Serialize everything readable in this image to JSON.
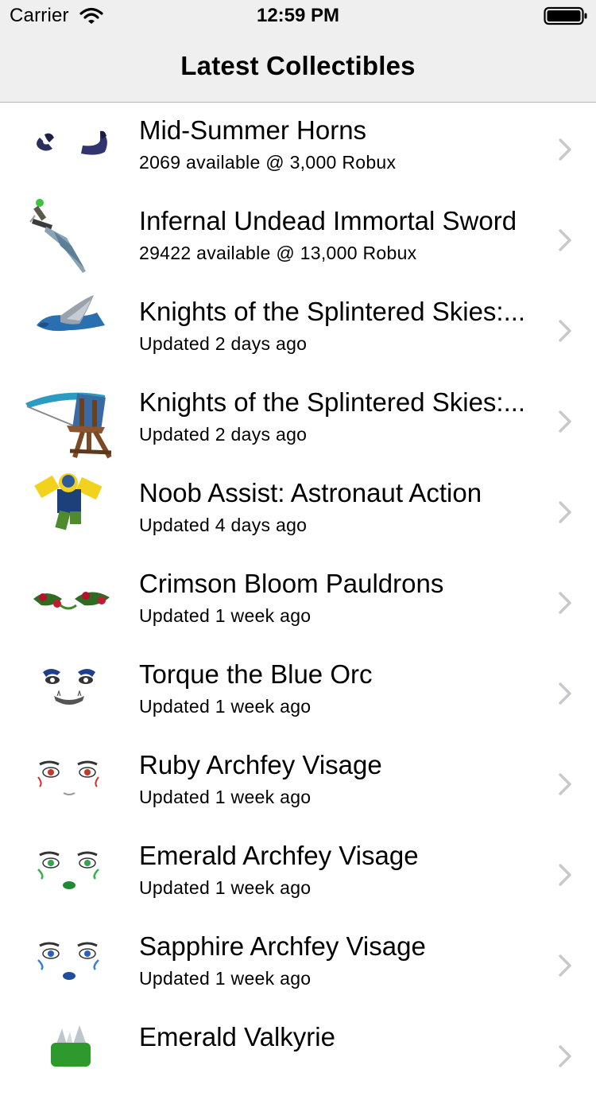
{
  "status_bar": {
    "carrier": "Carrier",
    "time": "12:59 PM",
    "icons": [
      "wifi-icon",
      "battery-icon"
    ]
  },
  "nav": {
    "title": "Latest Collectibles"
  },
  "items": [
    {
      "title": "Mid-Summer Horns",
      "subtitle": "2069 available @ 3,000 Robux",
      "thumb": "horns"
    },
    {
      "title": "Infernal Undead Immortal Sword",
      "subtitle": "29422 available @ 13,000 Robux",
      "thumb": "sword"
    },
    {
      "title": "Knights of the Splintered Skies:...",
      "subtitle": "Updated 2 days ago",
      "thumb": "wing"
    },
    {
      "title": "Knights of the Splintered Skies:...",
      "subtitle": "Updated 2 days ago",
      "thumb": "ballista"
    },
    {
      "title": "Noob Assist: Astronaut Action",
      "subtitle": "Updated 4 days ago",
      "thumb": "noob"
    },
    {
      "title": "Crimson Bloom Pauldrons",
      "subtitle": "Updated 1 week ago",
      "thumb": "pauldrons"
    },
    {
      "title": "Torque the Blue Orc",
      "subtitle": "Updated 1 week ago",
      "thumb": "orc"
    },
    {
      "title": "Ruby Archfey Visage",
      "subtitle": "Updated 1 week ago",
      "thumb": "ruby"
    },
    {
      "title": "Emerald Archfey Visage",
      "subtitle": "Updated 1 week ago",
      "thumb": "emerald"
    },
    {
      "title": "Sapphire Archfey Visage",
      "subtitle": "Updated 1 week ago",
      "thumb": "sapphire"
    },
    {
      "title": "Emerald Valkyrie",
      "subtitle": "",
      "thumb": "valkyrie"
    }
  ]
}
